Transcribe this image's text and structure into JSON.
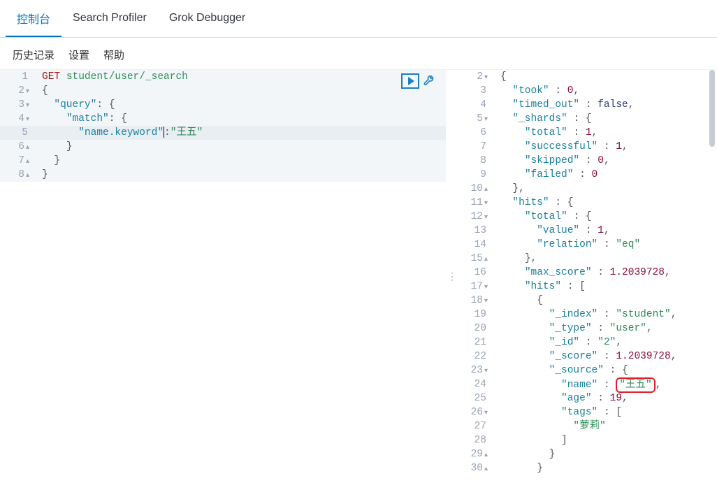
{
  "tabs": {
    "console": "控制台",
    "profiler": "Search Profiler",
    "grok": "Grok Debugger"
  },
  "toolbar": {
    "history": "历史记录",
    "settings": "设置",
    "help": "帮助"
  },
  "icons": {
    "play": "play-icon",
    "wrench": "wrench-icon"
  },
  "editor": {
    "method": "GET",
    "path": "student/user/_search",
    "query_key": "\"query\"",
    "match_key": "\"match\"",
    "field_key": "\"name.keyword\"",
    "field_val": "\"王五\"",
    "gutter": [
      "1",
      "2",
      "3",
      "4",
      "5",
      "6",
      "7",
      "8"
    ],
    "folds": [
      "",
      "▾",
      "▾",
      "▾",
      "",
      "▴",
      "▴",
      "▴"
    ]
  },
  "result": {
    "gutter": [
      "2",
      "3",
      "4",
      "5",
      "6",
      "7",
      "8",
      "9",
      "10",
      "11",
      "12",
      "13",
      "14",
      "15",
      "16",
      "17",
      "18",
      "19",
      "20",
      "21",
      "22",
      "23",
      "24",
      "25",
      "26",
      "27",
      "28",
      "29",
      "30"
    ],
    "folds": [
      "▾",
      "",
      "",
      "▾",
      "",
      "",
      "",
      "",
      "▴",
      "▾",
      "▾",
      "",
      "",
      "▴",
      "",
      "▾",
      "▾",
      "",
      "",
      "",
      "",
      "▾",
      "",
      "",
      "▾",
      "",
      "",
      "▴",
      "▴"
    ],
    "took": "\"took\"",
    "took_v": "0",
    "timed_out": "\"timed_out\"",
    "timed_out_v": "false",
    "shards": "\"_shards\"",
    "total": "\"total\"",
    "one": "1",
    "successful": "\"successful\"",
    "skipped": "\"skipped\"",
    "zero": "0",
    "failed": "\"failed\"",
    "hits": "\"hits\"",
    "value": "\"value\"",
    "relation": "\"relation\"",
    "relation_v": "\"eq\"",
    "max_score": "\"max_score\"",
    "max_score_v": "1.2039728",
    "index": "\"_index\"",
    "index_v": "\"student\"",
    "type": "\"_type\"",
    "type_v": "\"user\"",
    "id": "\"_id\"",
    "id_v": "\"2\"",
    "score": "\"_score\"",
    "source": "\"_source\"",
    "name": "\"name\"",
    "name_v": "\"王五\"",
    "age": "\"age\"",
    "age_v": "19",
    "tags": "\"tags\"",
    "tag0": "\"萝莉\""
  }
}
